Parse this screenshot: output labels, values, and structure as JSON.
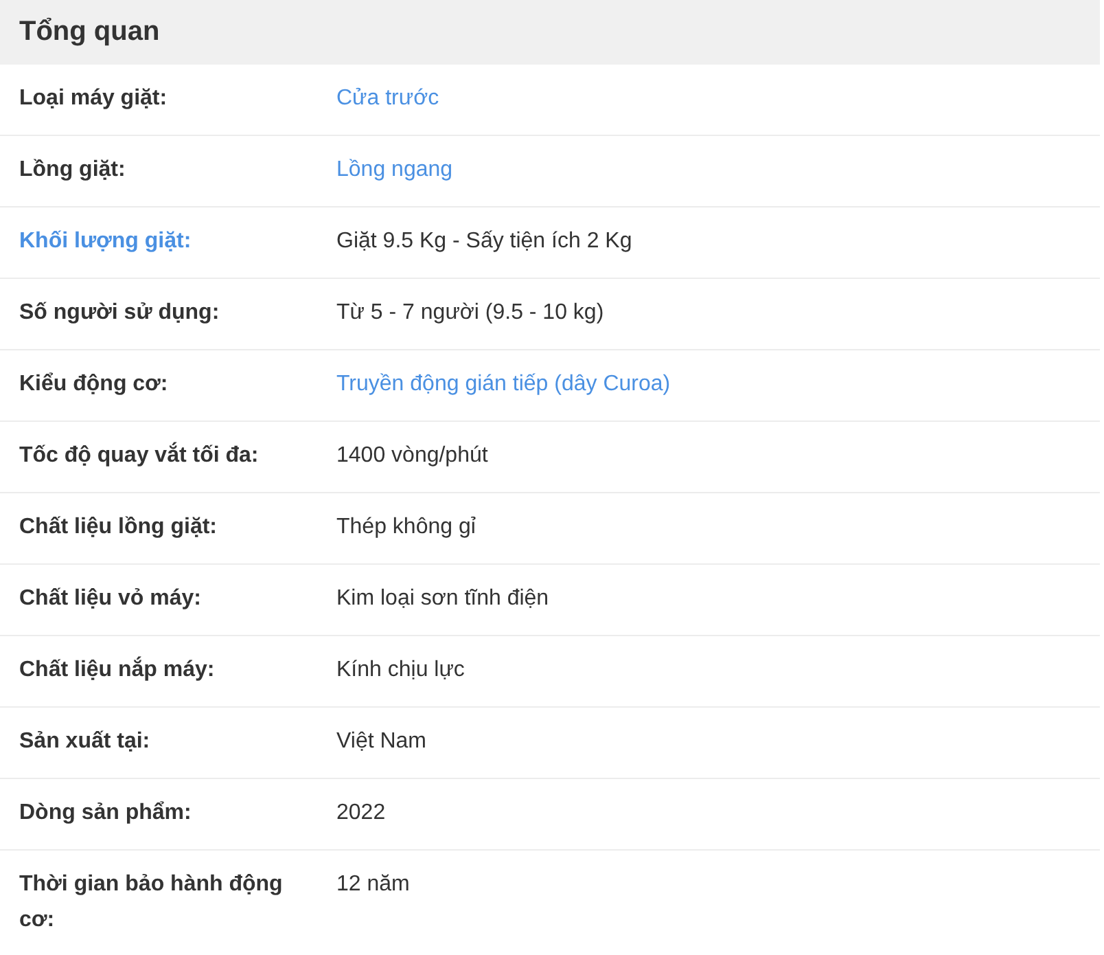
{
  "section": {
    "title": "Tổng quan"
  },
  "specs": [
    {
      "label": "Loại máy giặt:",
      "label_link": false,
      "value": "Cửa trước",
      "value_link": true
    },
    {
      "label": "Lồng giặt:",
      "label_link": false,
      "value": "Lồng ngang",
      "value_link": true
    },
    {
      "label": "Khối lượng giặt:",
      "label_link": true,
      "value": "Giặt 9.5 Kg - Sấy tiện ích 2 Kg",
      "value_link": false
    },
    {
      "label": "Số người sử dụng:",
      "label_link": false,
      "value": "Từ 5 - 7 người (9.5 - 10 kg)",
      "value_link": false
    },
    {
      "label": "Kiểu động cơ:",
      "label_link": false,
      "value": "Truyền động gián tiếp (dây Curoa)",
      "value_link": true
    },
    {
      "label": "Tốc độ quay vắt tối đa:",
      "label_link": false,
      "value": "1400 vòng/phút",
      "value_link": false
    },
    {
      "label": "Chất liệu lồng giặt:",
      "label_link": false,
      "value": "Thép không gỉ",
      "value_link": false
    },
    {
      "label": "Chất liệu vỏ máy:",
      "label_link": false,
      "value": "Kim loại sơn tĩnh điện",
      "value_link": false
    },
    {
      "label": "Chất liệu nắp máy:",
      "label_link": false,
      "value": "Kính chịu lực",
      "value_link": false
    },
    {
      "label": "Sản xuất tại:",
      "label_link": false,
      "value": "Việt Nam",
      "value_link": false
    },
    {
      "label": "Dòng sản phẩm:",
      "label_link": false,
      "value": "2022",
      "value_link": false
    },
    {
      "label": "Thời gian bảo hành động cơ:",
      "label_link": false,
      "value": "12 năm",
      "value_link": false
    }
  ]
}
